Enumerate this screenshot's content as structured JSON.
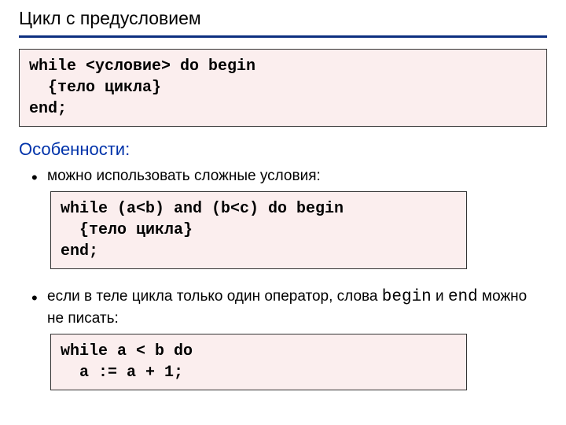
{
  "title": "Цикл с предусловием",
  "code1": "while <условие> do begin\n  {тело цикла}\nend;",
  "subhead": "Особенности:",
  "bullet1": "можно использовать сложные условия:",
  "code2": "while (a<b) and (b<c) do begin\n  {тело цикла}\nend;",
  "bullet2_pre": "если в теле цикла только один оператор, слова ",
  "bullet2_kw1": "begin",
  "bullet2_mid": " и ",
  "bullet2_kw2": "end",
  "bullet2_post": " можно не писать:",
  "code3": "while a < b do\n  a := a + 1;"
}
